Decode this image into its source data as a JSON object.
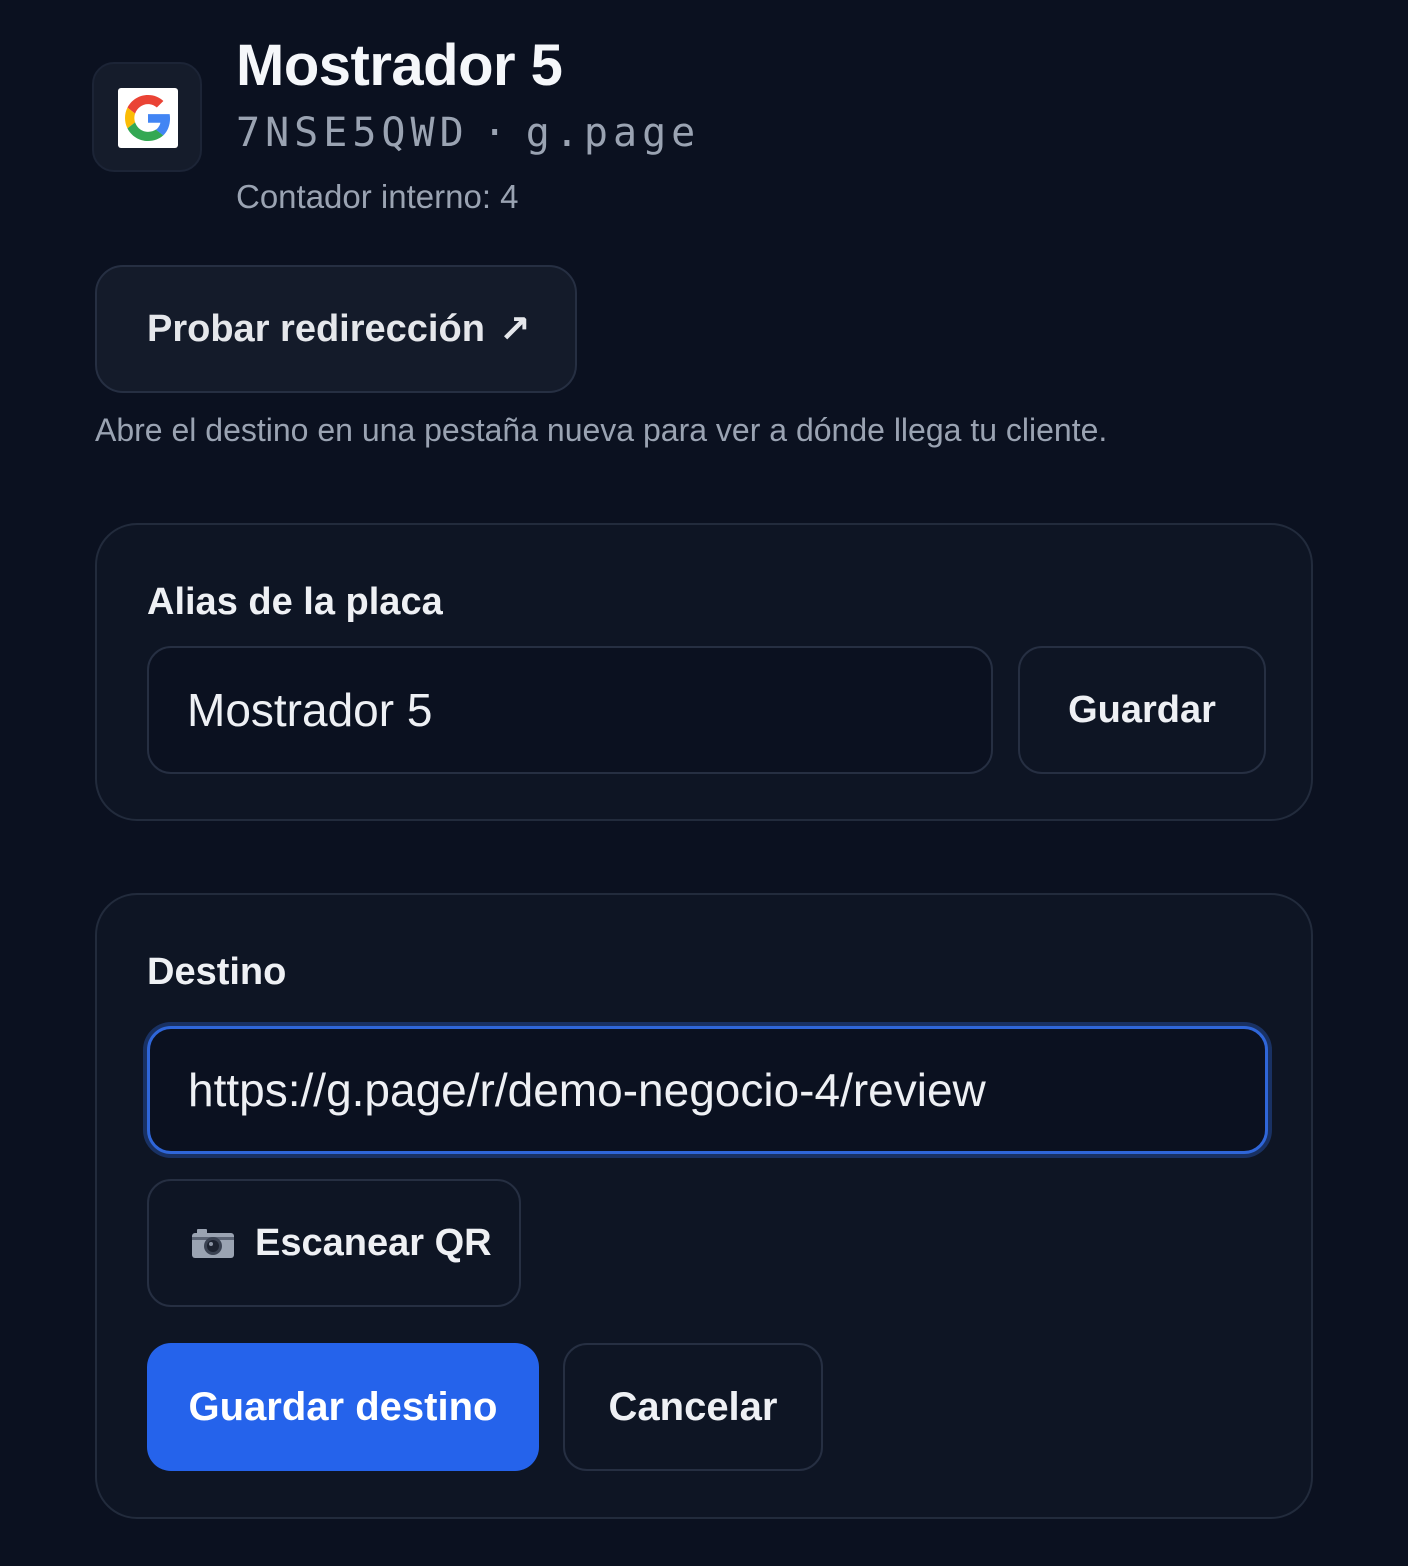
{
  "header": {
    "title": "Mostrador 5",
    "code": "7NSE5QWD",
    "separator": "·",
    "domain": "g.page",
    "counter": "Contador interno: 4",
    "logo_icon": "google-logo"
  },
  "test_redirect": {
    "label": "Probar redirección",
    "arrow": "↗",
    "hint": "Abre el destino en una pestaña nueva para ver a dónde llega tu cliente."
  },
  "alias_card": {
    "label": "Alias de la placa",
    "input_value": "Mostrador 5",
    "save_label": "Guardar"
  },
  "destination_card": {
    "label": "Destino",
    "input_value": "https://g.page/r/demo-negocio-4/review",
    "scan_label": "Escanear QR",
    "scan_icon": "camera-icon",
    "save_label": "Guardar destino",
    "cancel_label": "Cancelar"
  },
  "colors": {
    "background": "#0b1120",
    "card": "#0e1524",
    "primary": "#2563eb",
    "focus_ring": "#2f66d9",
    "muted_text": "#9aa3b2"
  }
}
